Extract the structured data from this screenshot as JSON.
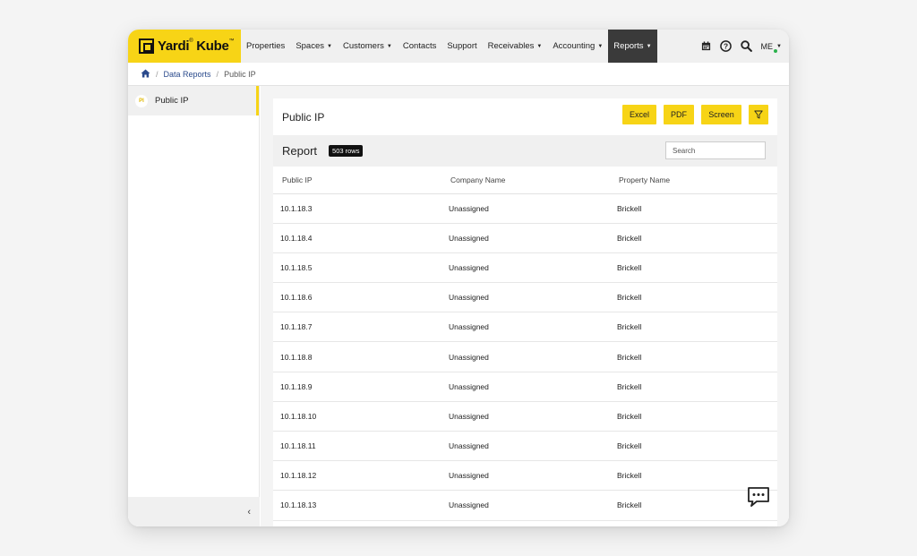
{
  "brand": {
    "name": "Yardi",
    "product": "Kube",
    "tm": "™",
    "accent": "#f7d416"
  },
  "nav": {
    "items": [
      {
        "label": "Properties",
        "caret": false
      },
      {
        "label": "Spaces",
        "caret": true
      },
      {
        "label": "Customers",
        "caret": true
      },
      {
        "label": "Contacts",
        "caret": false
      },
      {
        "label": "Support",
        "caret": false
      },
      {
        "label": "Receivables",
        "caret": true
      },
      {
        "label": "Accounting",
        "caret": true
      },
      {
        "label": "Reports",
        "caret": true,
        "active": true
      }
    ],
    "icons": [
      "calendar-icon",
      "help-icon",
      "search-icon"
    ],
    "user": "ME"
  },
  "breadcrumb": {
    "home_icon": "home-icon",
    "link": "Data Reports",
    "current": "Public IP"
  },
  "sidebar": {
    "items": [
      {
        "badge": "PI",
        "label": "Public IP"
      }
    ],
    "collapse_label": "‹"
  },
  "panel": {
    "title": "Public IP",
    "buttons": {
      "excel": "Excel",
      "pdf": "PDF",
      "screen": "Screen"
    },
    "report_title": "Report",
    "rows_badge": "503 rows",
    "search_placeholder": "Search"
  },
  "table": {
    "headers": [
      "Public IP",
      "Company Name",
      "Property Name"
    ],
    "rows": [
      [
        "10.1.18.3",
        "Unassigned",
        "Brickell"
      ],
      [
        "10.1.18.4",
        "Unassigned",
        "Brickell"
      ],
      [
        "10.1.18.5",
        "Unassigned",
        "Brickell"
      ],
      [
        "10.1.18.6",
        "Unassigned",
        "Brickell"
      ],
      [
        "10.1.18.7",
        "Unassigned",
        "Brickell"
      ],
      [
        "10.1.18.8",
        "Unassigned",
        "Brickell"
      ],
      [
        "10.1.18.9",
        "Unassigned",
        "Brickell"
      ],
      [
        "10.1.18.10",
        "Unassigned",
        "Brickell"
      ],
      [
        "10.1.18.11",
        "Unassigned",
        "Brickell"
      ],
      [
        "10.1.18.12",
        "Unassigned",
        "Brickell"
      ],
      [
        "10.1.18.13",
        "Unassigned",
        "Brickell"
      ]
    ]
  }
}
